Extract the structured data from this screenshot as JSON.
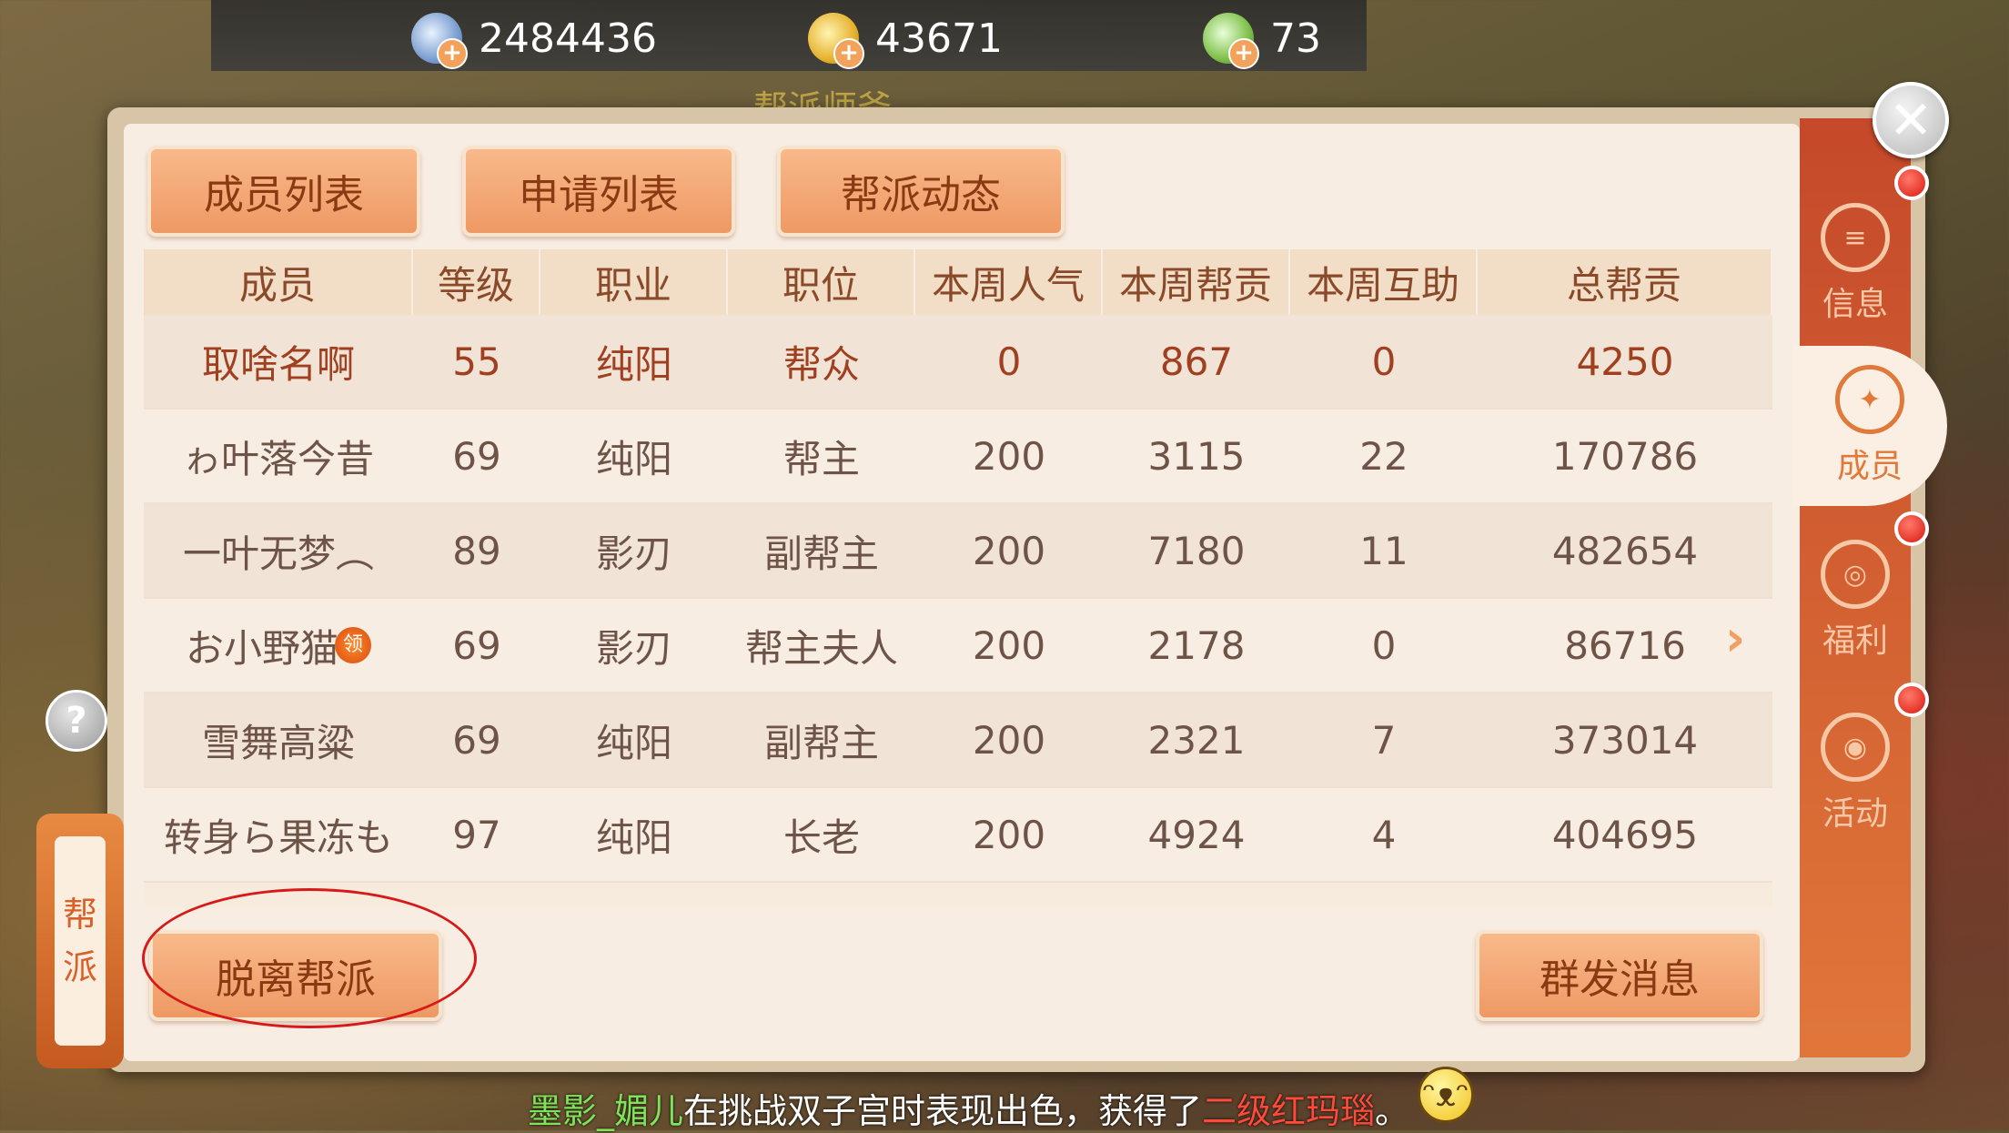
{
  "currency": [
    {
      "icon": "silver-coin-icon",
      "value": "2484436"
    },
    {
      "icon": "gold-coin-icon",
      "value": "43671"
    },
    {
      "icon": "jade-coin-icon",
      "value": "73"
    }
  ],
  "npc_label": "帮派师爷",
  "tabs": {
    "members": "成员列表",
    "applications": "申请列表",
    "news": "帮派动态"
  },
  "table": {
    "headers": [
      "成员",
      "等级",
      "职业",
      "职位",
      "本周人气",
      "本周帮贡",
      "本周互助",
      "总帮贡"
    ],
    "rows": [
      [
        "取啥名啊",
        "55",
        "纯阳",
        "帮众",
        "0",
        "867",
        "0",
        "4250"
      ],
      [
        "ゎ叶落今昔",
        "69",
        "纯阳",
        "帮主",
        "200",
        "3115",
        "22",
        "170786"
      ],
      [
        "一叶无梦︵",
        "89",
        "影刃",
        "副帮主",
        "200",
        "7180",
        "11",
        "482654"
      ],
      [
        "お小野猫",
        "69",
        "影刃",
        "帮主夫人",
        "200",
        "2178",
        "0",
        "86716"
      ],
      [
        "雪舞高粱",
        "69",
        "纯阳",
        "副帮主",
        "200",
        "2321",
        "7",
        "373014"
      ],
      [
        "转身ら果冻も",
        "97",
        "纯阳",
        "长老",
        "200",
        "4924",
        "4",
        "404695"
      ]
    ],
    "badge_text": "领"
  },
  "buttons": {
    "leave": "脱离帮派",
    "broadcast": "群发消息"
  },
  "side_tabs": [
    "信息",
    "成员",
    "福利",
    "活动"
  ],
  "gang_tab": [
    "帮",
    "派"
  ],
  "help_label": "?",
  "close_label": "✕",
  "notice": {
    "player": "墨影_媚儿",
    "text": "在挑战双子宫时表现出色，获得了",
    "item": "二级红玛瑙",
    "end": "。"
  }
}
